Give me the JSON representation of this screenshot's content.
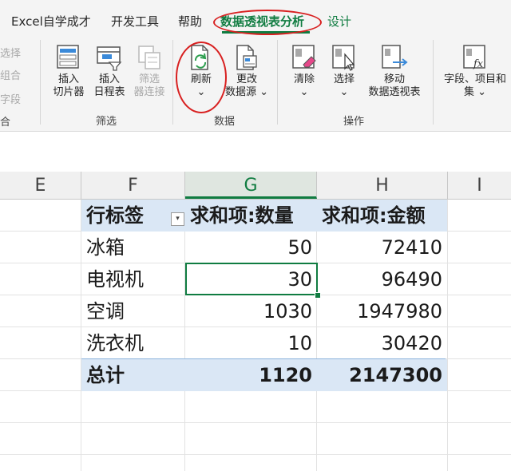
{
  "menu": {
    "tabs": [
      "Excel自学成才",
      "开发工具",
      "帮助",
      "数据透视表分析",
      "设计"
    ]
  },
  "ribbon": {
    "left_cut": [
      "选择",
      "组合",
      "字段",
      "合"
    ],
    "buttons": {
      "insert_slicer": [
        "插入",
        "切片器"
      ],
      "insert_timeline": [
        "插入",
        "日程表"
      ],
      "filter_connections": [
        "筛选",
        "器连接"
      ],
      "refresh": [
        "刷新",
        "⌄"
      ],
      "change_source": [
        "更改",
        "数据源 ⌄"
      ],
      "clear": [
        "清除",
        "⌄"
      ],
      "select": [
        "选择",
        "⌄"
      ],
      "move_pivot": [
        "移动",
        "数据透视表"
      ],
      "fields_items": [
        "字段、项目和",
        "集 ⌄"
      ]
    },
    "groups": [
      "筛选",
      "数据",
      "操作"
    ]
  },
  "sheet": {
    "columns": [
      "E",
      "F",
      "G",
      "H",
      "I"
    ],
    "selected_column": "G",
    "pivot": {
      "headers": [
        "行标签",
        "求和项:数量",
        "求和项:金额"
      ],
      "rows": [
        {
          "label": "冰箱",
          "qty": "50",
          "amount": "72410"
        },
        {
          "label": "电视机",
          "qty": "30",
          "amount": "96490"
        },
        {
          "label": "空调",
          "qty": "1030",
          "amount": "1947980"
        },
        {
          "label": "洗衣机",
          "qty": "10",
          "amount": "30420"
        }
      ],
      "total": {
        "label": "总计",
        "qty": "1120",
        "amount": "2147300"
      }
    }
  },
  "colors": {
    "excel_green": "#107c41",
    "annotation_red": "#d82020",
    "pivot_header_fill": "#dae7f5"
  }
}
